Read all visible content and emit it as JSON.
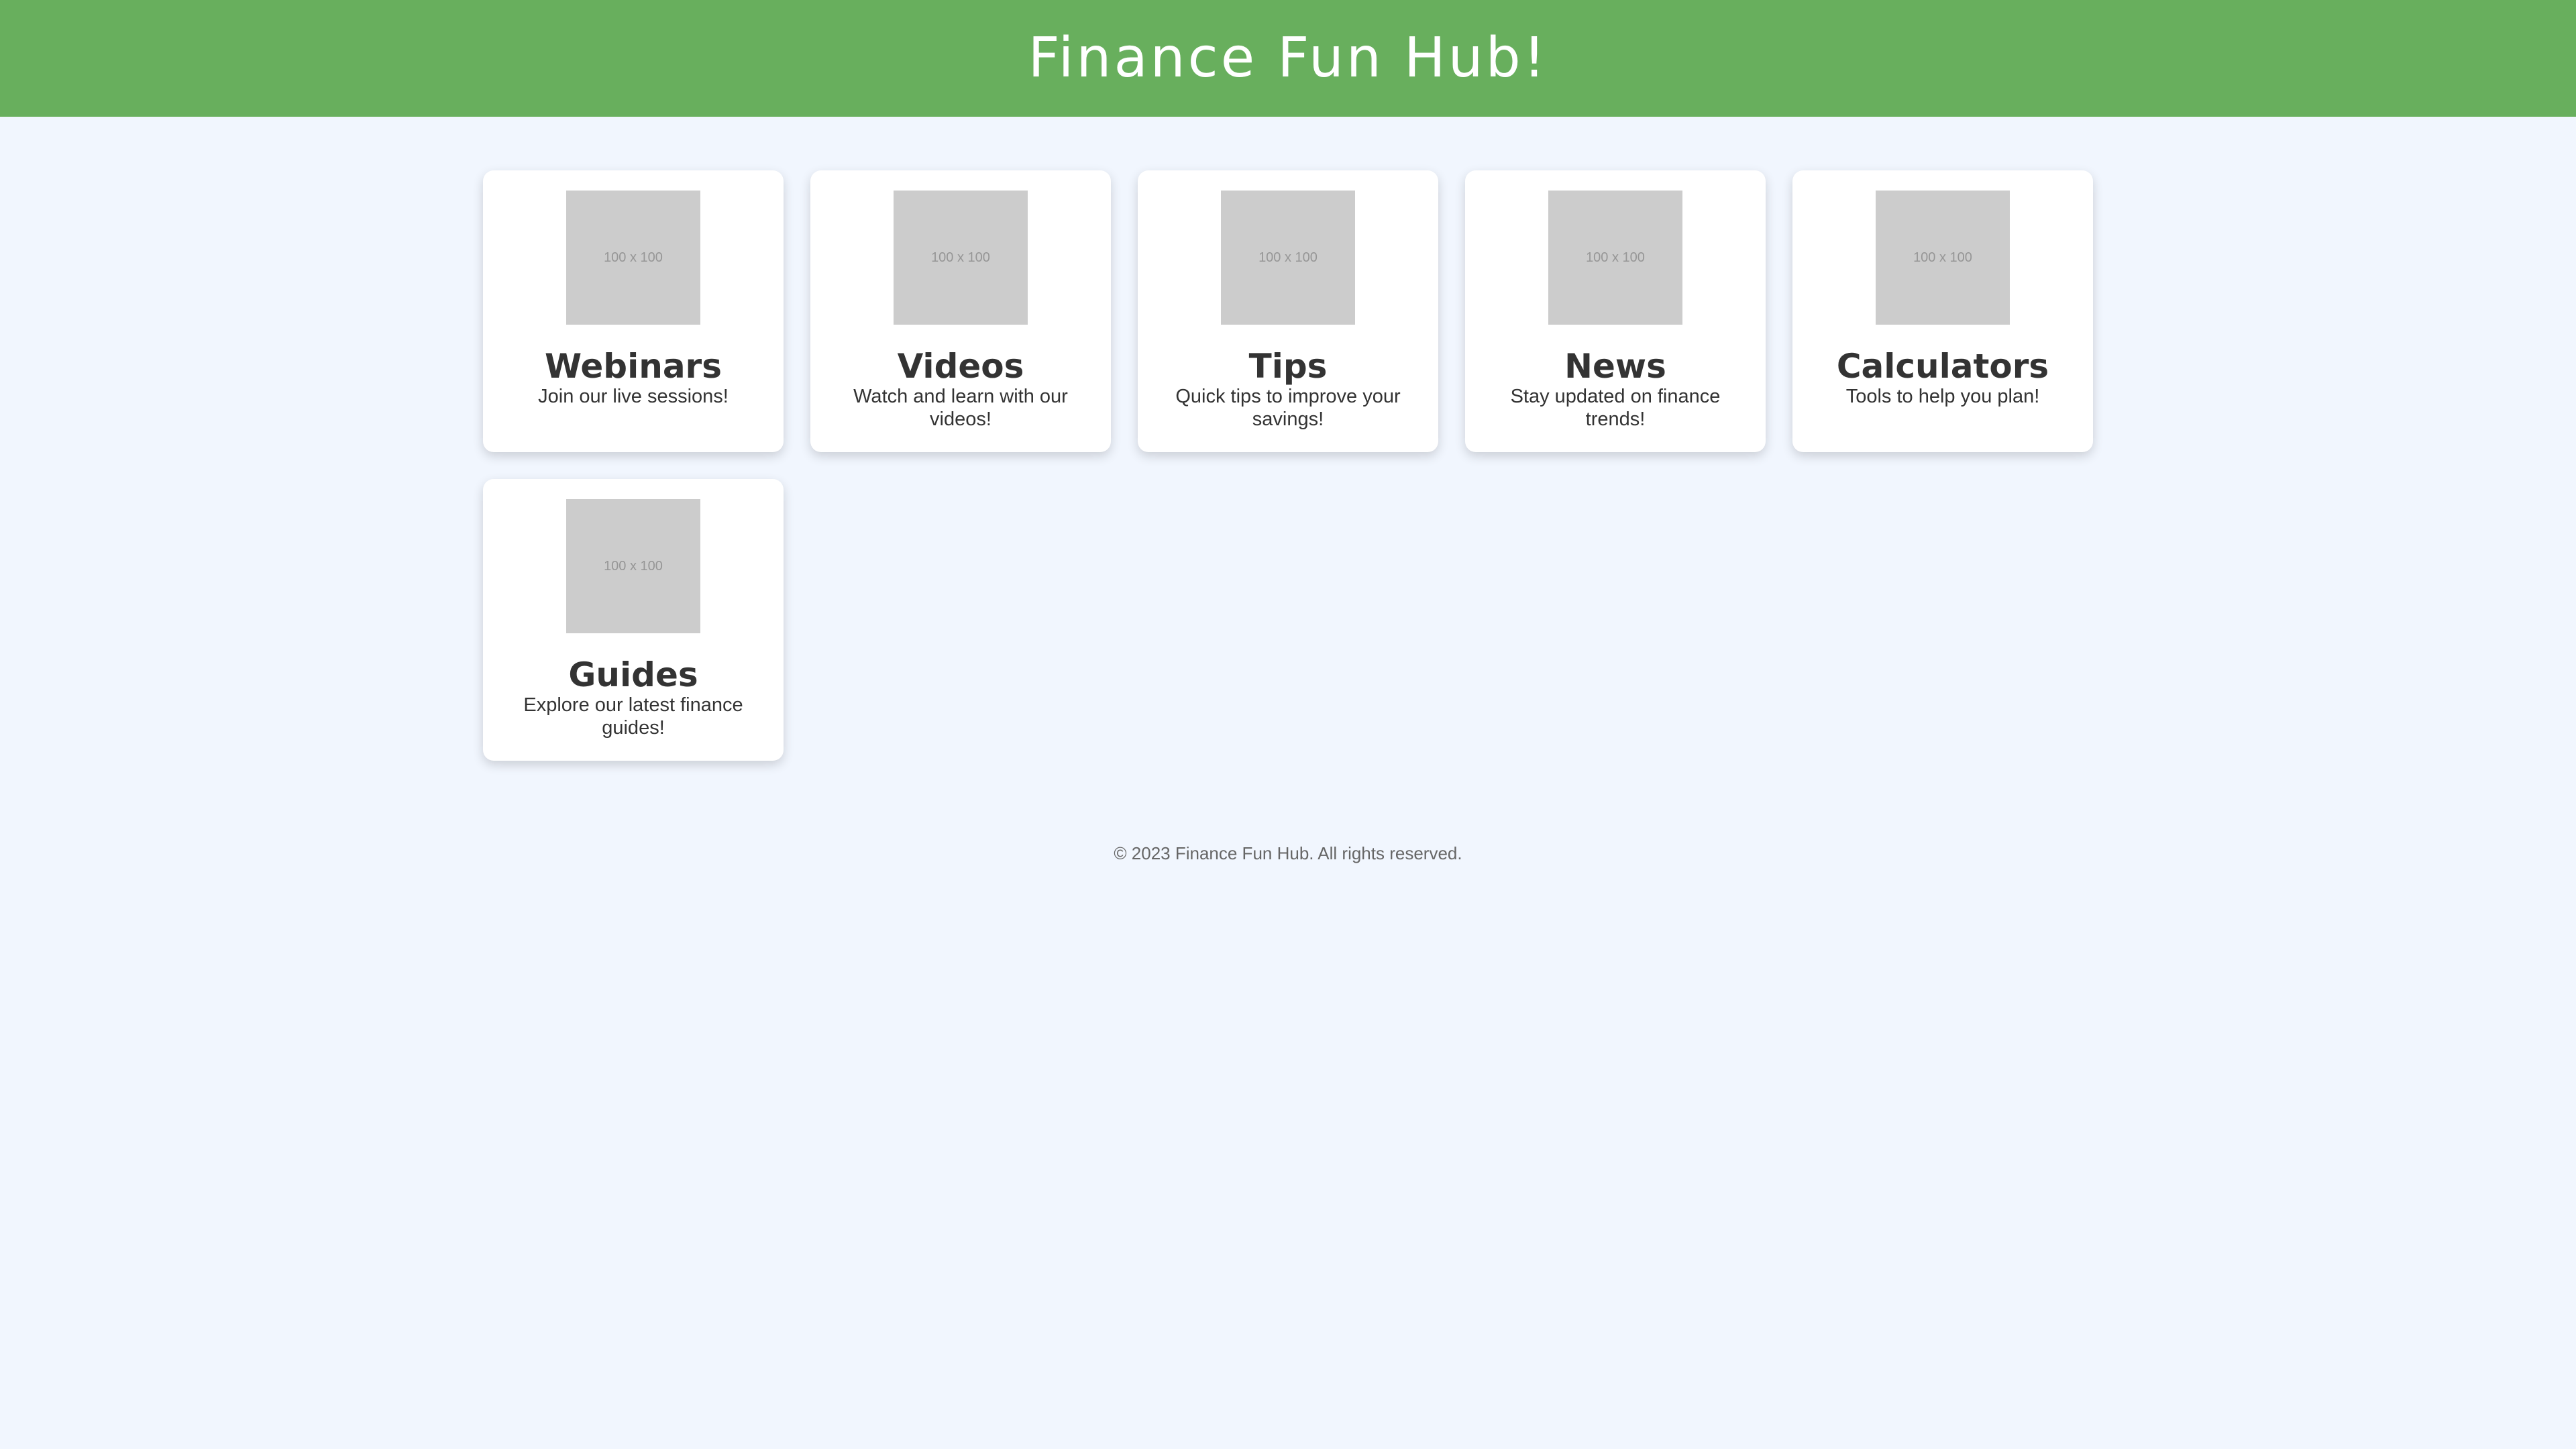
{
  "header": {
    "title": "Finance Fun Hub!"
  },
  "cards": [
    {
      "placeholder": "100 x 100",
      "title": "Webinars",
      "description": "Join our live sessions!"
    },
    {
      "placeholder": "100 x 100",
      "title": "Videos",
      "description": "Watch and learn with our videos!"
    },
    {
      "placeholder": "100 x 100",
      "title": "Tips",
      "description": "Quick tips to improve your savings!"
    },
    {
      "placeholder": "100 x 100",
      "title": "News",
      "description": "Stay updated on finance trends!"
    },
    {
      "placeholder": "100 x 100",
      "title": "Calculators",
      "description": "Tools to help you plan!"
    },
    {
      "placeholder": "100 x 100",
      "title": "Guides",
      "description": "Explore our latest finance guides!"
    }
  ],
  "footer": {
    "text": "© 2023 Finance Fun Hub. All rights reserved."
  },
  "colors": {
    "header_bg": "#68af5d",
    "page_bg": "#f1f6fe",
    "card_bg": "#ffffff",
    "placeholder_bg": "#cccccc"
  }
}
